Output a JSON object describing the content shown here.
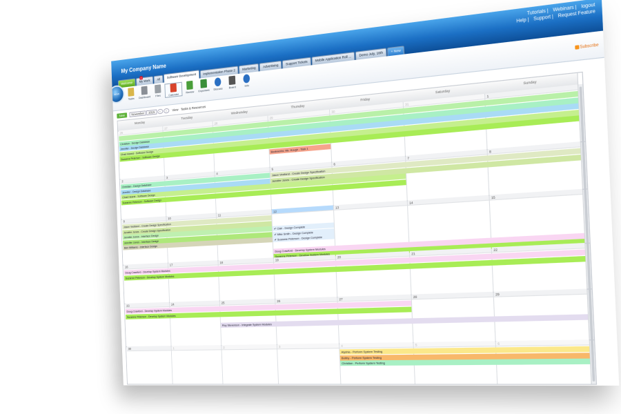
{
  "header": {
    "company": "My Company Name",
    "links_top": [
      "Tutorials",
      "Webinars",
      "logout"
    ],
    "links_bottom": [
      "Help",
      "Support",
      "Request Feature"
    ],
    "tabs": [
      {
        "label": "Welcome",
        "style": "green"
      },
      {
        "label": "My Work",
        "style": "normal",
        "badge": "2"
      },
      {
        "label": "All",
        "style": "normal"
      },
      {
        "label": "Software Development",
        "style": "active"
      },
      {
        "label": "Implementation Phase 2",
        "style": "normal"
      },
      {
        "label": "Marketing",
        "style": "normal"
      },
      {
        "label": "Advertising",
        "style": "normal"
      },
      {
        "label": "Support Tickets",
        "style": "normal"
      },
      {
        "label": "Mobile Application Roll ...",
        "style": "normal"
      },
      {
        "label": "Demo July, 16th",
        "style": "normal"
      },
      {
        "label": "New",
        "style": "add"
      }
    ]
  },
  "toolbar": {
    "logo_text": "NEW",
    "tools": [
      {
        "label": "Tasks",
        "icon": "tasks-icon",
        "color": "#d9b64a"
      },
      {
        "label": "Dashboard",
        "icon": "dashboard-icon",
        "color": "#8a8f96"
      },
      {
        "label": "Files",
        "icon": "files-icon",
        "color": "#9aa0a6"
      },
      {
        "label": "Calendar",
        "icon": "calendar-icon",
        "color": "#d8442b",
        "selected": true
      },
      {
        "label": "Review",
        "icon": "review-icon",
        "color": "#4a9e3a"
      },
      {
        "label": "Expenses",
        "icon": "expenses-icon",
        "color": "#3a8f3a"
      },
      {
        "label": "Discuss",
        "icon": "discuss-icon",
        "color": "#2a6fc2"
      },
      {
        "label": "Board",
        "icon": "board-icon",
        "color": "#555555"
      },
      {
        "label": "Info",
        "icon": "info-icon",
        "color": "#2a6fc2"
      }
    ],
    "subscribe": "Subscribe"
  },
  "calendar": {
    "new_label": "New",
    "month": "November",
    "year": "2015",
    "view_label": "View",
    "view_options": "Tasks & Resources",
    "weekdays": [
      "Monday",
      "Tuesday",
      "Wednesday",
      "Thursday",
      "Friday",
      "Saturday",
      "Sunday"
    ],
    "weeks": [
      {
        "days": [
          {
            "n": "26",
            "other": true
          },
          {
            "n": "27",
            "other": true
          },
          {
            "n": "28",
            "other": true
          },
          {
            "n": "29",
            "other": true
          },
          {
            "n": "30",
            "other": true
          },
          {
            "n": "31",
            "other": true
          },
          {
            "n": "1"
          }
        ],
        "events": [
          {
            "label": "",
            "start": 0,
            "span": 7,
            "row": 0,
            "color": "#b9f0a8"
          },
          {
            "label": "Christian - Design Database",
            "start": 0,
            "span": 7,
            "row": 1,
            "color": "#a8f0c4"
          },
          {
            "label": "Jennifer - Design Database",
            "start": 0,
            "span": 7,
            "row": 2,
            "color": "#a9dbf5"
          },
          {
            "label": "Chad Hearst - Software Design",
            "start": 0,
            "span": 7,
            "row": 3,
            "color": "#c5ef8e"
          },
          {
            "label": "Suzanne Peterson - Software Design",
            "start": 0,
            "span": 7,
            "row": 4,
            "color": "#a8ec56"
          },
          {
            "label": "Bookworks: Ms. Hough - Task 1",
            "start": 3,
            "span": 1,
            "row": 5,
            "color": "#f6a48c"
          }
        ]
      },
      {
        "days": [
          {
            "n": "2"
          },
          {
            "n": "3"
          },
          {
            "n": "4"
          },
          {
            "n": "5"
          },
          {
            "n": "6"
          },
          {
            "n": "7"
          },
          {
            "n": "8"
          }
        ],
        "events": [
          {
            "label": "Christian - Design Database",
            "start": 0,
            "span": 3,
            "row": 0,
            "color": "#a8f0c4"
          },
          {
            "label": "Jason Vestland - Create Design Specification",
            "start": 3,
            "span": 4,
            "row": 0,
            "color": "#dfe9c3"
          },
          {
            "label": "Jennifer - Design Database",
            "start": 0,
            "span": 3,
            "row": 1,
            "color": "#a9dbf5"
          },
          {
            "label": "Jennifer Jones - Create Design Specification",
            "start": 3,
            "span": 4,
            "row": 1,
            "color": "#cfe7a3"
          },
          {
            "label": "Chad Hearst - Software Design",
            "start": 0,
            "span": 5,
            "row": 2,
            "color": "#c5ef8e"
          },
          {
            "label": "Suzanne Peterson - Software Design",
            "start": 0,
            "span": 5,
            "row": 3,
            "color": "#a8ec56"
          }
        ]
      },
      {
        "days": [
          {
            "n": "9"
          },
          {
            "n": "10"
          },
          {
            "n": "11"
          },
          {
            "n": "12",
            "today": true
          },
          {
            "n": "13"
          },
          {
            "n": "14"
          },
          {
            "n": "15"
          }
        ],
        "events": [
          {
            "label": "Jason Vestland - Create Design Specification",
            "start": 0,
            "span": 3,
            "row": 0,
            "color": "#dfe9c3"
          },
          {
            "label": "Jennifer Jones - Create Design Specification",
            "start": 0,
            "span": 3,
            "row": 1,
            "color": "#cfe7a3"
          },
          {
            "label": "Jennifer Jones - Interface Design",
            "start": 0,
            "span": 3,
            "row": 2,
            "color": "#bff0b0"
          },
          {
            "label": "Jennifer Jones - Interface Design",
            "start": 0,
            "span": 3,
            "row": 3,
            "color": "#aee87a"
          },
          {
            "label": "Ben Williams - Interface Design",
            "start": 0,
            "span": 3,
            "row": 4,
            "color": "#d5d5b8"
          },
          {
            "label": "✔ Clair - Design Complete",
            "start": 3,
            "span": 1,
            "row": 2,
            "color": "#e2effb"
          },
          {
            "label": "✔ Mike Smith - Design Complete",
            "start": 3,
            "span": 1,
            "row": 3,
            "color": "#e2effb"
          },
          {
            "label": "✔ Suzanne Peterson - Design Complete",
            "start": 3,
            "span": 1,
            "row": 4,
            "color": "#e2effb"
          },
          {
            "label": "Doug Crawford - Develop System Modules",
            "start": 3,
            "span": 4,
            "row": 6,
            "color": "#f9d6f2"
          },
          {
            "label": "Suzanne Peterson - Develop System Modules",
            "start": 3,
            "span": 4,
            "row": 7,
            "color": "#a8ec56"
          }
        ]
      },
      {
        "days": [
          {
            "n": "16"
          },
          {
            "n": "17"
          },
          {
            "n": "18"
          },
          {
            "n": "19"
          },
          {
            "n": "20"
          },
          {
            "n": "21"
          },
          {
            "n": "22"
          }
        ],
        "events": [
          {
            "label": "Doug Crawford - Develop System Modules",
            "start": 0,
            "span": 7,
            "row": 0,
            "color": "#f9d6f2"
          },
          {
            "label": "Suzanne Peterson - Develop System Modules",
            "start": 0,
            "span": 7,
            "row": 1,
            "color": "#a8ec56"
          }
        ]
      },
      {
        "days": [
          {
            "n": "23"
          },
          {
            "n": "24"
          },
          {
            "n": "25"
          },
          {
            "n": "26"
          },
          {
            "n": "27"
          },
          {
            "n": "28"
          },
          {
            "n": "29"
          }
        ],
        "events": [
          {
            "label": "Doug Crawford - Develop System Modules",
            "start": 0,
            "span": 5,
            "row": 0,
            "color": "#f9d6f2"
          },
          {
            "label": "Suzanne Peterson - Develop System Modules",
            "start": 0,
            "span": 5,
            "row": 1,
            "color": "#a8ec56"
          },
          {
            "label": "Roy Stevenson - Integrate System Modules",
            "start": 2,
            "span": 5,
            "row": 3,
            "color": "#e3dcef"
          }
        ]
      },
      {
        "days": [
          {
            "n": "30"
          },
          {
            "n": "1",
            "other": true
          },
          {
            "n": "2",
            "other": true
          },
          {
            "n": "3",
            "other": true
          },
          {
            "n": "4",
            "other": true
          },
          {
            "n": "5",
            "other": true
          },
          {
            "n": "6",
            "other": true
          }
        ],
        "events": [
          {
            "label": "Alyshia - Perform System Testing",
            "start": 4,
            "span": 3,
            "row": 0,
            "color": "#fbe88a"
          },
          {
            "label": "Bobby - Perform System Testing",
            "start": 4,
            "span": 3,
            "row": 1,
            "color": "#f8b86a"
          },
          {
            "label": "Christian - Perform System Testing",
            "start": 4,
            "span": 3,
            "row": 2,
            "color": "#a8f0c4"
          }
        ]
      }
    ]
  }
}
